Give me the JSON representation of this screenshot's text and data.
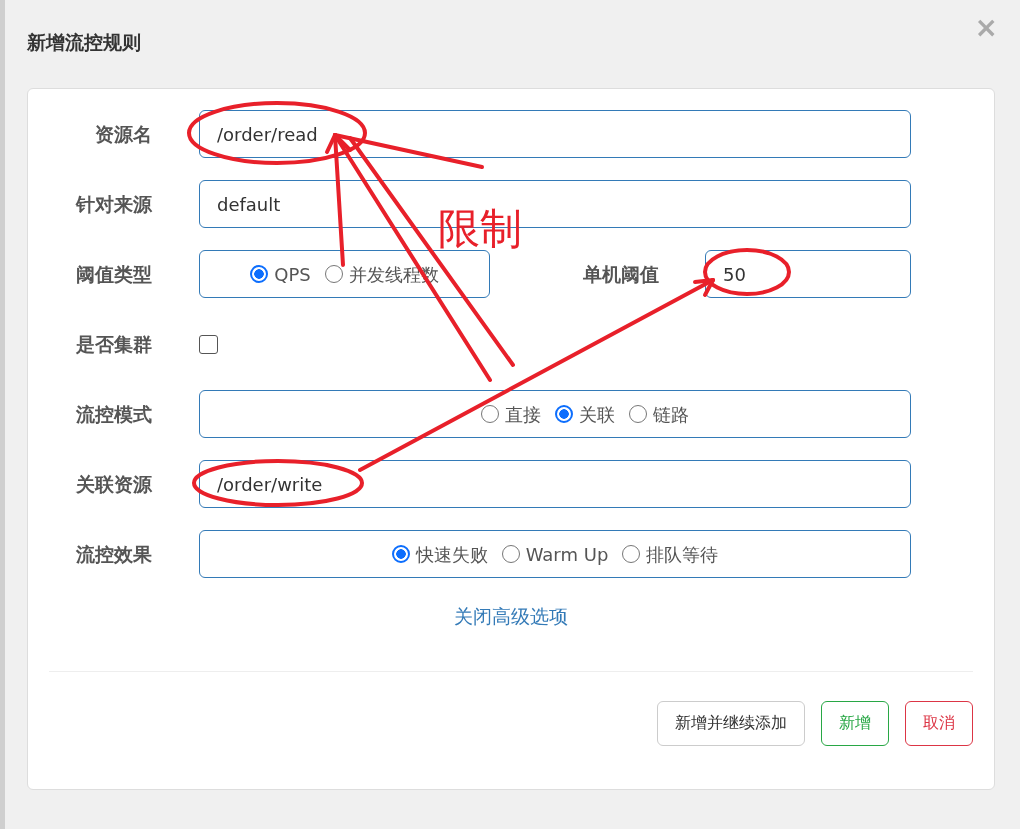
{
  "dialog": {
    "title": "新增流控规则",
    "close": "×"
  },
  "fields": [
    {
      "kind": "text",
      "label": "资源名",
      "value": "/order/read"
    },
    {
      "kind": "text",
      "label": "针对来源",
      "value": "default"
    },
    {
      "kind": "radio_with_input",
      "label": "阈值类型",
      "options": [
        {
          "label": "QPS",
          "selected": true
        },
        {
          "label": "并发线程数",
          "selected": false
        }
      ],
      "side_label": "单机阈值",
      "side_value": "50"
    },
    {
      "kind": "checkbox",
      "label": "是否集群",
      "checked": false
    },
    {
      "kind": "radio",
      "label": "流控模式",
      "options": [
        {
          "label": "直接",
          "selected": false
        },
        {
          "label": "关联",
          "selected": true
        },
        {
          "label": "链路",
          "selected": false
        }
      ]
    },
    {
      "kind": "text",
      "label": "关联资源",
      "value": "/order/write"
    },
    {
      "kind": "radio",
      "label": "流控效果",
      "options": [
        {
          "label": "快速失败",
          "selected": true
        },
        {
          "label": "Warm Up",
          "selected": false
        },
        {
          "label": "排队等待",
          "selected": false
        }
      ]
    }
  ],
  "advanced_link": "关闭高级选项",
  "buttons": [
    {
      "label": "新增并继续添加",
      "kind": "default"
    },
    {
      "label": "新增",
      "kind": "success"
    },
    {
      "label": "取消",
      "kind": "danger"
    }
  ],
  "annotation": {
    "text": "限制"
  }
}
